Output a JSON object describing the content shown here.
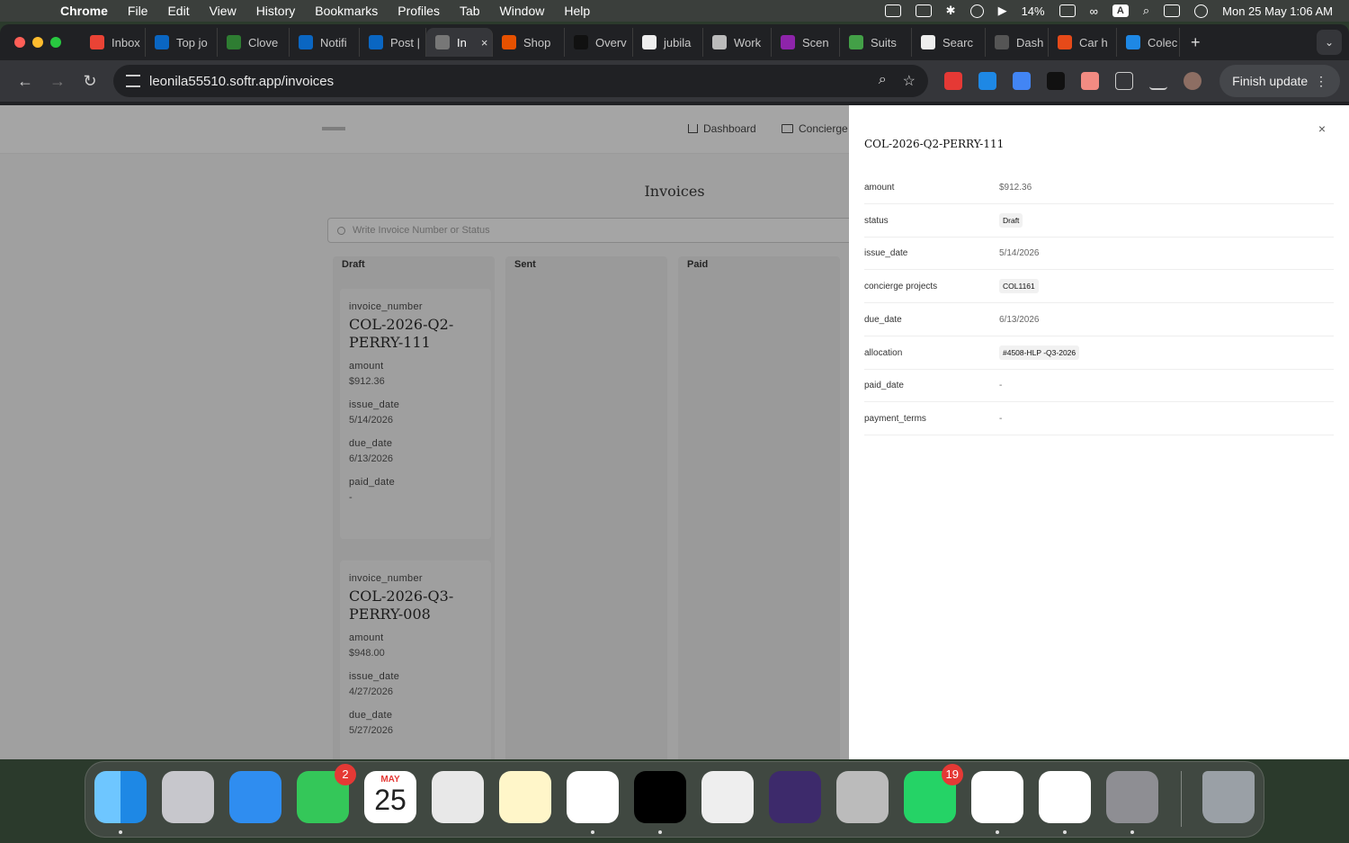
{
  "menubar": {
    "app_name": "Chrome",
    "menus": [
      "File",
      "Edit",
      "View",
      "History",
      "Bookmarks",
      "Profiles",
      "Tab",
      "Window",
      "Help"
    ],
    "battery": "14%",
    "input_source": "A",
    "datetime": "Mon 25 May  1:06 AM"
  },
  "browser": {
    "tabs": [
      {
        "label": "Inbox",
        "color": "#ea4335"
      },
      {
        "label": "Top jo",
        "color": "#0a66c2"
      },
      {
        "label": "Clove",
        "color": "#2e7d32"
      },
      {
        "label": "Notifi",
        "color": "#0a66c2"
      },
      {
        "label": "Post |",
        "color": "#0a66c2"
      },
      {
        "label": "In",
        "color": "#777777"
      },
      {
        "label": "Shop",
        "color": "#e65100"
      },
      {
        "label": "Overv",
        "color": "#111111"
      },
      {
        "label": "jubila",
        "color": "#eeeeee"
      },
      {
        "label": "Work",
        "color": "#bbbbbb"
      },
      {
        "label": "Scen",
        "color": "#8e24aa"
      },
      {
        "label": "Suits",
        "color": "#43a047"
      },
      {
        "label": "Searc",
        "color": "#eeeeee"
      },
      {
        "label": "Dash",
        "color": "#555555"
      },
      {
        "label": "Car h",
        "color": "#e64a19"
      },
      {
        "label": "Colec",
        "color": "#1e88e5"
      }
    ],
    "active_tab_index": 5,
    "new_tab": "+",
    "url": "leonila55510.softr.app/invoices",
    "finish_update": "Finish update"
  },
  "page": {
    "nav": [
      {
        "label": "Dashboard",
        "icon": "home-icon"
      },
      {
        "label": "Concierge",
        "icon": "folder-icon"
      }
    ],
    "title": "Invoices",
    "search_placeholder": "Write Invoice Number or Status",
    "columns": [
      "Draft",
      "Sent",
      "Paid"
    ],
    "cards": [
      {
        "invoice_number_label": "invoice_number",
        "invoice_number": "COL-2026-Q2-PERRY-111",
        "amount_label": "amount",
        "amount": "$912.36",
        "issue_date_label": "issue_date",
        "issue_date": "5/14/2026",
        "due_date_label": "due_date",
        "due_date": "6/13/2026",
        "paid_date_label": "paid_date",
        "paid_date": "-"
      },
      {
        "invoice_number_label": "invoice_number",
        "invoice_number": "COL-2026-Q3-PERRY-008",
        "amount_label": "amount",
        "amount": "$948.00",
        "issue_date_label": "issue_date",
        "issue_date": "4/27/2026",
        "due_date_label": "due_date",
        "due_date": "5/27/2026"
      }
    ]
  },
  "drawer": {
    "title": "COL-2026-Q2-PERRY-111",
    "close": "×",
    "rows": [
      {
        "key": "amount",
        "value": "$912.36"
      },
      {
        "key": "status",
        "value": "Draft"
      },
      {
        "key": "issue_date",
        "value": "5/14/2026"
      },
      {
        "key": "concierge projects",
        "value": "COL1161"
      },
      {
        "key": "due_date",
        "value": "6/13/2026"
      },
      {
        "key": "allocation",
        "value": "#4508-HLP -Q3-2026"
      },
      {
        "key": "paid_date",
        "value": "-"
      },
      {
        "key": "payment_terms",
        "value": "-"
      }
    ]
  },
  "dock": {
    "calendar_month": "MAY",
    "calendar_day": "25",
    "messages_badge": "2",
    "whatsapp_badge": "19",
    "apps": [
      "finder-icon",
      "launchpad-icon",
      "mail-icon",
      "messages-icon",
      "calendar-icon",
      "maps-icon",
      "notes-icon",
      "chrome-icon",
      "spotify-icon",
      "calculator-icon",
      "firefox-icon",
      "iphone-mirroring-icon",
      "whatsapp-icon",
      "slack-icon",
      "windows-app-icon",
      "system-settings-icon",
      "trash-icon"
    ]
  }
}
